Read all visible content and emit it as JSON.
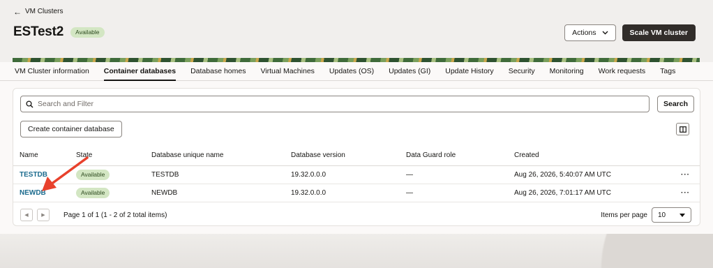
{
  "header": {
    "back_label": "VM Clusters",
    "title": "ESTest2",
    "status": "Available",
    "actions_label": "Actions",
    "scale_label": "Scale VM cluster"
  },
  "tabs": [
    {
      "label": "VM Cluster information",
      "active": false
    },
    {
      "label": "Container databases",
      "active": true
    },
    {
      "label": "Database homes",
      "active": false
    },
    {
      "label": "Virtual Machines",
      "active": false
    },
    {
      "label": "Updates (OS)",
      "active": false
    },
    {
      "label": "Updates (GI)",
      "active": false
    },
    {
      "label": "Update History",
      "active": false
    },
    {
      "label": "Security",
      "active": false
    },
    {
      "label": "Monitoring",
      "active": false
    },
    {
      "label": "Work requests",
      "active": false
    },
    {
      "label": "Tags",
      "active": false
    }
  ],
  "toolbar": {
    "search_placeholder": "Search and Filter",
    "search_button": "Search",
    "create_button": "Create container database"
  },
  "table": {
    "columns": [
      "Name",
      "State",
      "Database unique name",
      "Database version",
      "Data Guard role",
      "Created"
    ],
    "rows": [
      {
        "name": "TESTDB",
        "state": "Available",
        "unique_name": "TESTDB",
        "version": "19.32.0.0.0",
        "dg_role": "—",
        "created": "Aug 26, 2026, 5:40:07 AM UTC"
      },
      {
        "name": "NEWDB",
        "state": "Available",
        "unique_name": "NEWDB",
        "version": "19.32.0.0.0",
        "dg_role": "—",
        "created": "Aug 26, 2026, 7:01:17 AM UTC"
      }
    ]
  },
  "pager": {
    "text": "Page 1 of 1 (1 - 2 of 2 total items)",
    "ipp_label": "Items per page",
    "ipp_value": "10"
  },
  "colors": {
    "accent_link": "#1b6b8e",
    "primary_button": "#312d2a",
    "badge_green": "#d3e6c3",
    "annotation_arrow": "#e8412c"
  }
}
